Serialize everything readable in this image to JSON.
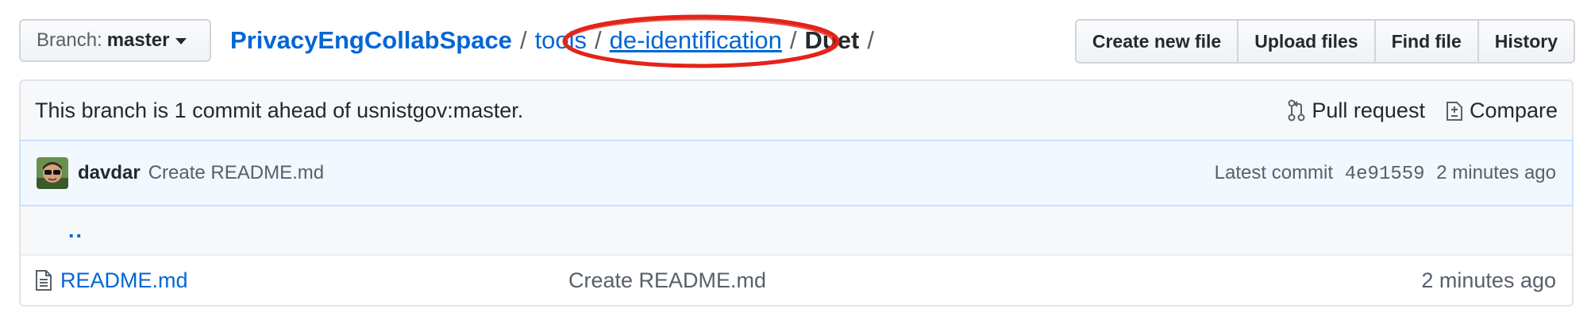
{
  "branch": {
    "label": "Branch:",
    "value": "master"
  },
  "breadcrumb": {
    "repo": "PrivacyEngCollabSpace",
    "sep": "/",
    "items": [
      "tools",
      "de-identification"
    ],
    "current": "Duet",
    "trailing": "/"
  },
  "actions": {
    "create": "Create new file",
    "upload": "Upload files",
    "find": "Find file",
    "history": "History"
  },
  "branch_info": {
    "message": "This branch is 1 commit ahead of usnistgov:master.",
    "pull_request": "Pull request",
    "compare": "Compare"
  },
  "commit": {
    "author": "davdar",
    "message": "Create README.md",
    "latest_label": "Latest commit",
    "sha": "4e91559",
    "age": "2 minutes ago"
  },
  "files": {
    "up": "..",
    "rows": [
      {
        "name": "README.md",
        "message": "Create README.md",
        "age": "2 minutes ago"
      }
    ]
  },
  "colors": {
    "link": "#0366d6",
    "annotation": "#e3231a"
  }
}
